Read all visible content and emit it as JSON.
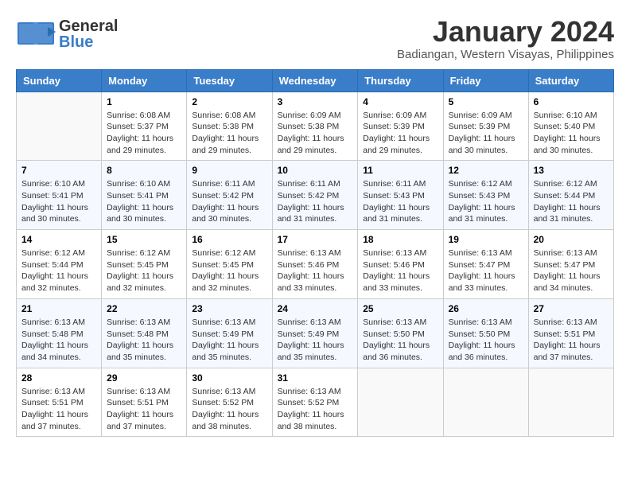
{
  "header": {
    "logo_general": "General",
    "logo_blue": "Blue",
    "month_title": "January 2024",
    "location": "Badiangan, Western Visayas, Philippines"
  },
  "days_of_week": [
    "Sunday",
    "Monday",
    "Tuesday",
    "Wednesday",
    "Thursday",
    "Friday",
    "Saturday"
  ],
  "weeks": [
    {
      "days": [
        {
          "num": "",
          "sunrise": "",
          "sunset": "",
          "daylight": ""
        },
        {
          "num": "1",
          "sunrise": "Sunrise: 6:08 AM",
          "sunset": "Sunset: 5:37 PM",
          "daylight": "Daylight: 11 hours and 29 minutes."
        },
        {
          "num": "2",
          "sunrise": "Sunrise: 6:08 AM",
          "sunset": "Sunset: 5:38 PM",
          "daylight": "Daylight: 11 hours and 29 minutes."
        },
        {
          "num": "3",
          "sunrise": "Sunrise: 6:09 AM",
          "sunset": "Sunset: 5:38 PM",
          "daylight": "Daylight: 11 hours and 29 minutes."
        },
        {
          "num": "4",
          "sunrise": "Sunrise: 6:09 AM",
          "sunset": "Sunset: 5:39 PM",
          "daylight": "Daylight: 11 hours and 29 minutes."
        },
        {
          "num": "5",
          "sunrise": "Sunrise: 6:09 AM",
          "sunset": "Sunset: 5:39 PM",
          "daylight": "Daylight: 11 hours and 30 minutes."
        },
        {
          "num": "6",
          "sunrise": "Sunrise: 6:10 AM",
          "sunset": "Sunset: 5:40 PM",
          "daylight": "Daylight: 11 hours and 30 minutes."
        }
      ]
    },
    {
      "days": [
        {
          "num": "7",
          "sunrise": "Sunrise: 6:10 AM",
          "sunset": "Sunset: 5:41 PM",
          "daylight": "Daylight: 11 hours and 30 minutes."
        },
        {
          "num": "8",
          "sunrise": "Sunrise: 6:10 AM",
          "sunset": "Sunset: 5:41 PM",
          "daylight": "Daylight: 11 hours and 30 minutes."
        },
        {
          "num": "9",
          "sunrise": "Sunrise: 6:11 AM",
          "sunset": "Sunset: 5:42 PM",
          "daylight": "Daylight: 11 hours and 30 minutes."
        },
        {
          "num": "10",
          "sunrise": "Sunrise: 6:11 AM",
          "sunset": "Sunset: 5:42 PM",
          "daylight": "Daylight: 11 hours and 31 minutes."
        },
        {
          "num": "11",
          "sunrise": "Sunrise: 6:11 AM",
          "sunset": "Sunset: 5:43 PM",
          "daylight": "Daylight: 11 hours and 31 minutes."
        },
        {
          "num": "12",
          "sunrise": "Sunrise: 6:12 AM",
          "sunset": "Sunset: 5:43 PM",
          "daylight": "Daylight: 11 hours and 31 minutes."
        },
        {
          "num": "13",
          "sunrise": "Sunrise: 6:12 AM",
          "sunset": "Sunset: 5:44 PM",
          "daylight": "Daylight: 11 hours and 31 minutes."
        }
      ]
    },
    {
      "days": [
        {
          "num": "14",
          "sunrise": "Sunrise: 6:12 AM",
          "sunset": "Sunset: 5:44 PM",
          "daylight": "Daylight: 11 hours and 32 minutes."
        },
        {
          "num": "15",
          "sunrise": "Sunrise: 6:12 AM",
          "sunset": "Sunset: 5:45 PM",
          "daylight": "Daylight: 11 hours and 32 minutes."
        },
        {
          "num": "16",
          "sunrise": "Sunrise: 6:12 AM",
          "sunset": "Sunset: 5:45 PM",
          "daylight": "Daylight: 11 hours and 32 minutes."
        },
        {
          "num": "17",
          "sunrise": "Sunrise: 6:13 AM",
          "sunset": "Sunset: 5:46 PM",
          "daylight": "Daylight: 11 hours and 33 minutes."
        },
        {
          "num": "18",
          "sunrise": "Sunrise: 6:13 AM",
          "sunset": "Sunset: 5:46 PM",
          "daylight": "Daylight: 11 hours and 33 minutes."
        },
        {
          "num": "19",
          "sunrise": "Sunrise: 6:13 AM",
          "sunset": "Sunset: 5:47 PM",
          "daylight": "Daylight: 11 hours and 33 minutes."
        },
        {
          "num": "20",
          "sunrise": "Sunrise: 6:13 AM",
          "sunset": "Sunset: 5:47 PM",
          "daylight": "Daylight: 11 hours and 34 minutes."
        }
      ]
    },
    {
      "days": [
        {
          "num": "21",
          "sunrise": "Sunrise: 6:13 AM",
          "sunset": "Sunset: 5:48 PM",
          "daylight": "Daylight: 11 hours and 34 minutes."
        },
        {
          "num": "22",
          "sunrise": "Sunrise: 6:13 AM",
          "sunset": "Sunset: 5:48 PM",
          "daylight": "Daylight: 11 hours and 35 minutes."
        },
        {
          "num": "23",
          "sunrise": "Sunrise: 6:13 AM",
          "sunset": "Sunset: 5:49 PM",
          "daylight": "Daylight: 11 hours and 35 minutes."
        },
        {
          "num": "24",
          "sunrise": "Sunrise: 6:13 AM",
          "sunset": "Sunset: 5:49 PM",
          "daylight": "Daylight: 11 hours and 35 minutes."
        },
        {
          "num": "25",
          "sunrise": "Sunrise: 6:13 AM",
          "sunset": "Sunset: 5:50 PM",
          "daylight": "Daylight: 11 hours and 36 minutes."
        },
        {
          "num": "26",
          "sunrise": "Sunrise: 6:13 AM",
          "sunset": "Sunset: 5:50 PM",
          "daylight": "Daylight: 11 hours and 36 minutes."
        },
        {
          "num": "27",
          "sunrise": "Sunrise: 6:13 AM",
          "sunset": "Sunset: 5:51 PM",
          "daylight": "Daylight: 11 hours and 37 minutes."
        }
      ]
    },
    {
      "days": [
        {
          "num": "28",
          "sunrise": "Sunrise: 6:13 AM",
          "sunset": "Sunset: 5:51 PM",
          "daylight": "Daylight: 11 hours and 37 minutes."
        },
        {
          "num": "29",
          "sunrise": "Sunrise: 6:13 AM",
          "sunset": "Sunset: 5:51 PM",
          "daylight": "Daylight: 11 hours and 37 minutes."
        },
        {
          "num": "30",
          "sunrise": "Sunrise: 6:13 AM",
          "sunset": "Sunset: 5:52 PM",
          "daylight": "Daylight: 11 hours and 38 minutes."
        },
        {
          "num": "31",
          "sunrise": "Sunrise: 6:13 AM",
          "sunset": "Sunset: 5:52 PM",
          "daylight": "Daylight: 11 hours and 38 minutes."
        },
        {
          "num": "",
          "sunrise": "",
          "sunset": "",
          "daylight": ""
        },
        {
          "num": "",
          "sunrise": "",
          "sunset": "",
          "daylight": ""
        },
        {
          "num": "",
          "sunrise": "",
          "sunset": "",
          "daylight": ""
        }
      ]
    }
  ]
}
